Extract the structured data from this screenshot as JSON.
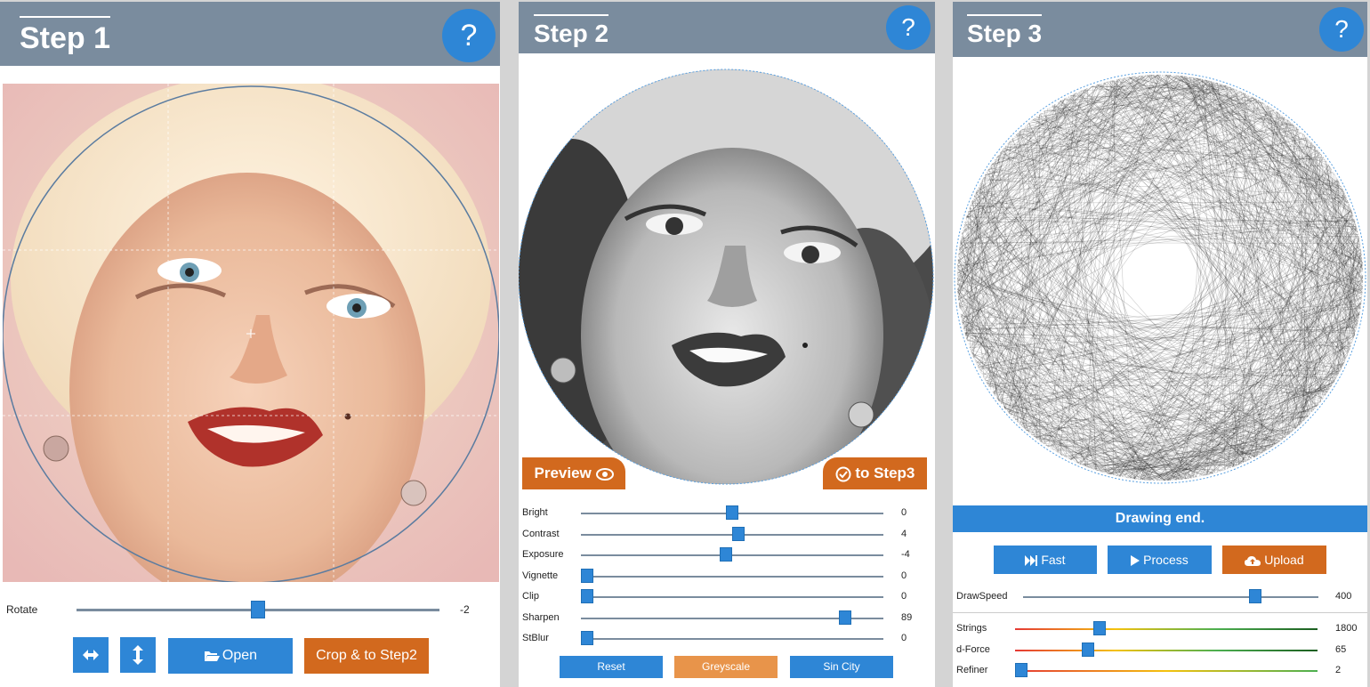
{
  "step1": {
    "title": "Step 1",
    "help": "?",
    "rotate": {
      "label": "Rotate",
      "value": "-2",
      "fraction": 0.5
    },
    "buttons": {
      "open": "Open",
      "crop": "Crop & to Step2"
    },
    "icons": [
      "flip-horizontal-icon",
      "flip-vertical-icon",
      "folder-open-icon"
    ]
  },
  "step2": {
    "title": "Step 2",
    "help": "?",
    "preview": "Preview",
    "to_step3": "to Step3",
    "sliders": [
      {
        "label": "Bright",
        "value": "0",
        "fraction": 0.5
      },
      {
        "label": "Contrast",
        "value": "4",
        "fraction": 0.52
      },
      {
        "label": "Exposure",
        "value": "-4",
        "fraction": 0.48
      },
      {
        "label": "Vignette",
        "value": "0",
        "fraction": 0.0
      },
      {
        "label": "Clip",
        "value": "0",
        "fraction": 0.0
      },
      {
        "label": "Sharpen",
        "value": "89",
        "fraction": 0.89
      },
      {
        "label": "StBlur",
        "value": "0",
        "fraction": 0.0
      }
    ],
    "buttons": {
      "reset": "Reset",
      "greyscale": "Greyscale",
      "sincity": "Sin City"
    }
  },
  "step3": {
    "title": "Step 3",
    "help": "?",
    "status": "Drawing end.",
    "buttons": {
      "fast": "Fast",
      "process": "Process",
      "upload": "Upload"
    },
    "drawspeed": {
      "label": "DrawSpeed",
      "value": "400",
      "fraction": 0.8
    },
    "sliders": [
      {
        "label": "Strings",
        "value": "1800",
        "fraction": 0.27
      },
      {
        "label": "d-Force",
        "value": "65",
        "fraction": 0.23
      },
      {
        "label": "Refiner",
        "value": "2",
        "fraction": 0.0
      }
    ]
  },
  "colors": {
    "header": "#7a8c9e",
    "accent_blue": "#2e86d6",
    "accent_orange": "#d2691e"
  }
}
